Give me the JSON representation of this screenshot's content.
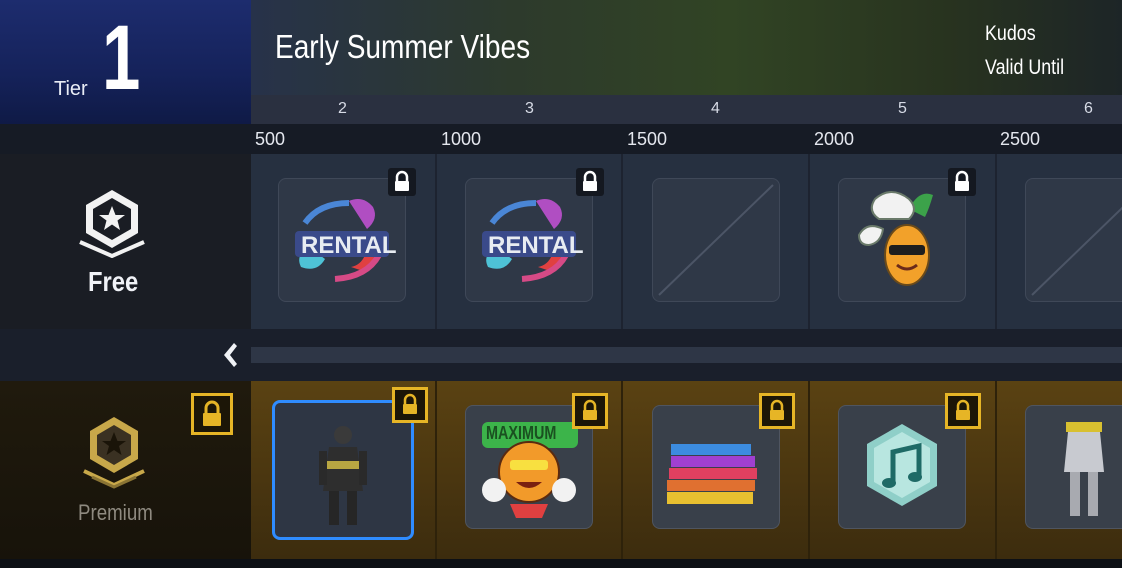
{
  "header": {
    "tier_label": "Tier",
    "tier_number": "1",
    "season_title": "Early Summer Vibes",
    "kudos_label": "Kudos",
    "valid_until_label": "Valid Until"
  },
  "levels": [
    "2",
    "3",
    "4",
    "5",
    "6"
  ],
  "points": [
    "500",
    "1000",
    "1500",
    "2000",
    "2500"
  ],
  "free_track": {
    "label": "Free",
    "rewards": [
      {
        "icon": "rental-sticker-icon",
        "text": "RENTAL",
        "locked": true
      },
      {
        "icon": "rental-sticker-icon",
        "text": "RENTAL",
        "locked": true
      },
      {
        "icon": "empty-slot-icon",
        "locked": false
      },
      {
        "icon": "pineapple-chef-sticker-icon",
        "locked": true
      },
      {
        "icon": "empty-slot-icon",
        "locked": false
      }
    ]
  },
  "premium_track": {
    "label": "Premium",
    "locked": true,
    "rewards": [
      {
        "icon": "character-outfit-icon",
        "selected": true,
        "locked": true
      },
      {
        "icon": "maximum-sticker-icon",
        "text": "MAXIMUM",
        "locked": true
      },
      {
        "icon": "color-stack-icon",
        "locked": true
      },
      {
        "icon": "music-note-badge-icon",
        "locked": true
      },
      {
        "icon": "character-outfit-icon",
        "locked": false
      }
    ]
  },
  "colors": {
    "tier_blue": "#1d2c6e",
    "premium_gold": "#e6b526",
    "selection_blue": "#2f8cff"
  }
}
